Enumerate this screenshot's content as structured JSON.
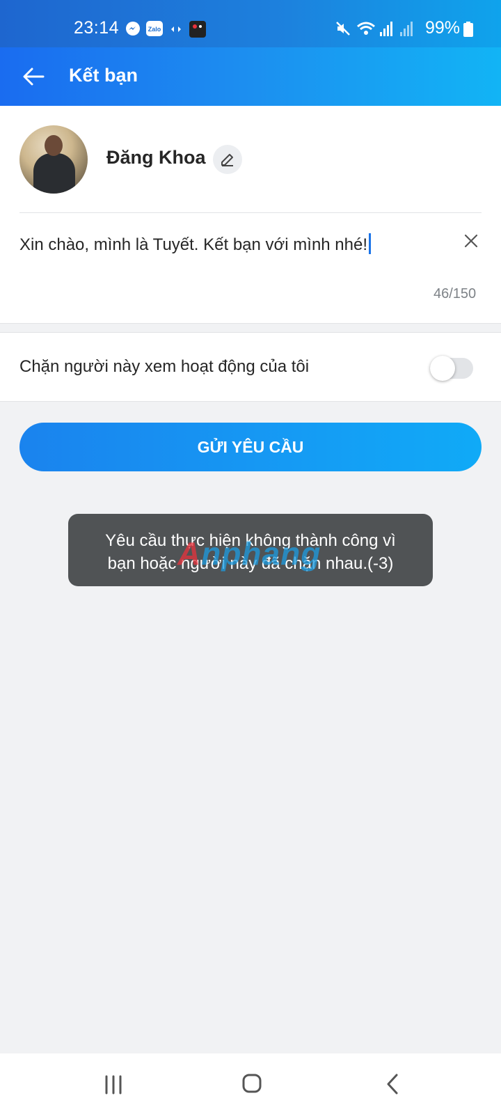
{
  "status_bar": {
    "time": "23:14",
    "battery": "99%",
    "icons": [
      "messenger-icon",
      "zalo-icon",
      "sync-icon",
      "app-icon",
      "mute-icon",
      "wifi-icon",
      "signal-icon",
      "signal-icon",
      "battery-icon"
    ]
  },
  "header": {
    "title": "Kết bạn",
    "back_icon": "arrow-left-icon"
  },
  "profile": {
    "name": "Đăng Khoa",
    "edit_icon": "pencil-icon"
  },
  "message": {
    "value": "Xin chào, mình là Tuyết. Kết bạn với mình nhé!",
    "counter": "46/150",
    "clear_icon": "close-icon"
  },
  "block_option": {
    "label": "Chặn người này xem hoạt động của tôi",
    "enabled": false
  },
  "send_button": {
    "label": "GỬI YÊU CẦU"
  },
  "toast": {
    "line1": "Yêu cầu thực hiện không thành công vì",
    "line2": "bạn hoặc người này đã chặn nhau.(-3)"
  },
  "watermark": {
    "letter": "A",
    "rest": "nphang"
  },
  "nav": {
    "icons": [
      "recents-icon",
      "home-icon",
      "back-icon"
    ]
  },
  "colors": {
    "accent": "#1a83ee",
    "toast_bg": "#505355"
  }
}
